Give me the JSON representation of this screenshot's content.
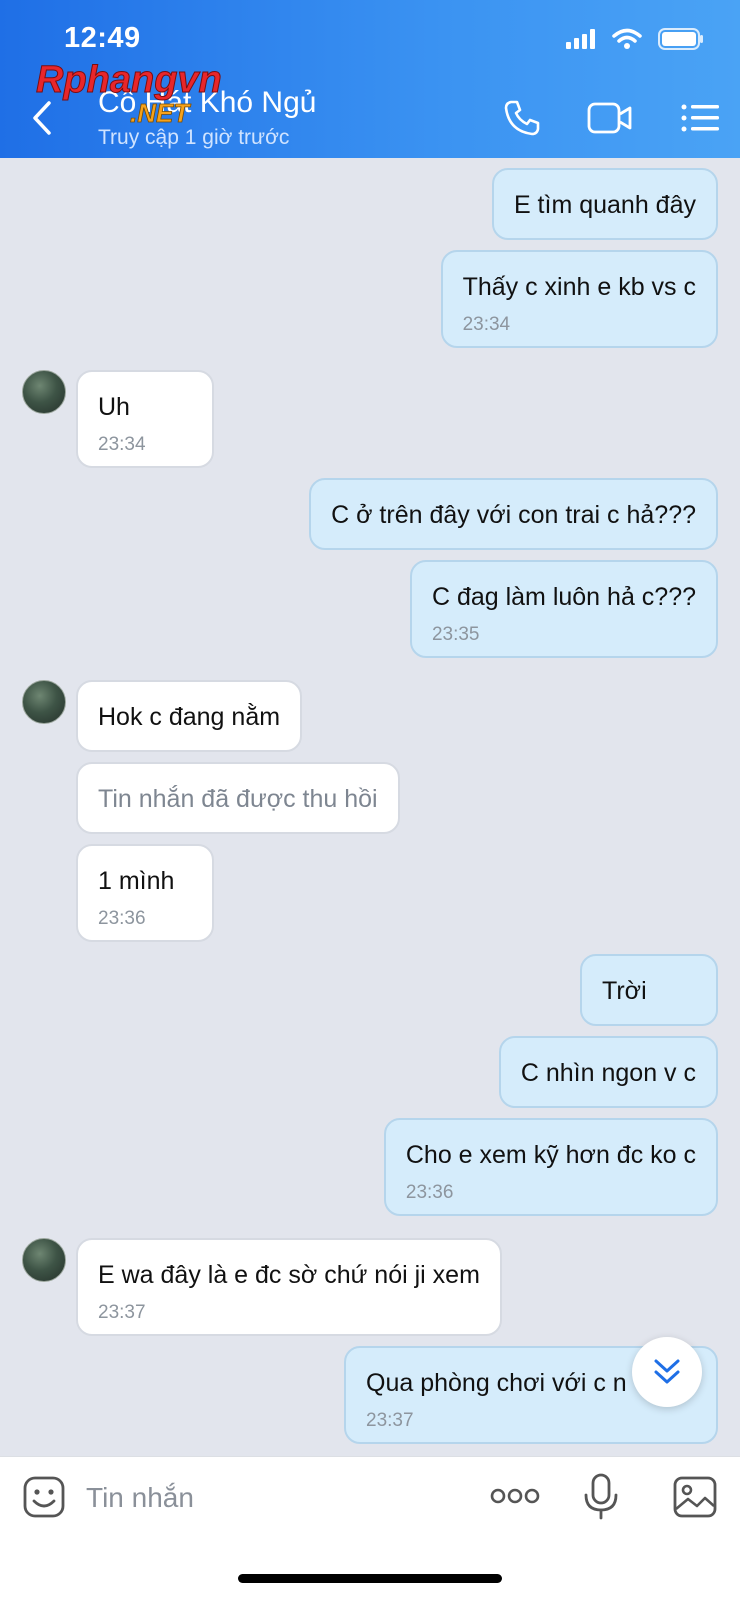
{
  "status_bar": {
    "time": "12:49"
  },
  "header": {
    "contact_name": "Cô Hát Khó Ngủ",
    "contact_status": "Truy cập 1 giờ trước",
    "watermark_text": "Rphangvn",
    "watermark_sub": ".NET"
  },
  "messages": [
    {
      "text": "E tìm quanh đây",
      "time": ""
    },
    {
      "text": "Thấy c xinh e kb vs c",
      "time": "23:34"
    },
    {
      "text": "Uh",
      "time": "23:34"
    },
    {
      "text": "C ở trên đây với con trai c hả???",
      "time": ""
    },
    {
      "text": "C đag làm luôn hả c???",
      "time": "23:35"
    },
    {
      "text": "Hok c đang nằm",
      "time": ""
    },
    {
      "text": "Tin nhắn đã được thu hồi",
      "time": ""
    },
    {
      "text": "1 mình",
      "time": "23:36"
    },
    {
      "text": "Trời",
      "time": ""
    },
    {
      "text": "C nhìn ngon v c",
      "time": ""
    },
    {
      "text": "Cho e xem kỹ hơn đc ko c",
      "time": "23:36"
    },
    {
      "text": "E wa đây là e đc sờ chứ nói ji xem",
      "time": "23:37"
    },
    {
      "text": "Qua phòng chơi với c n",
      "time": "23:37"
    }
  ],
  "composer": {
    "placeholder": "Tin nhắn"
  },
  "colors": {
    "header_blue": "#2b82ee",
    "outgoing_bubble": "#d5ecfb",
    "incoming_bubble": "#ffffff",
    "chat_bg": "#e2e5ed"
  }
}
